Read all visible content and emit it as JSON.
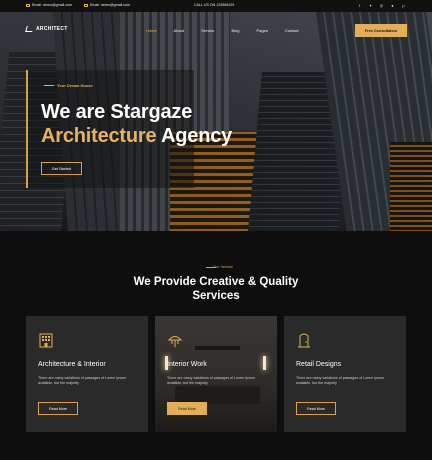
{
  "topbar": {
    "email1": "Email: demo@gmail.com",
    "email2": "Email: demo@gmail.com",
    "call": "CALL US ON 125566429",
    "socials": [
      "facebook-icon",
      "twitter-icon",
      "instagram-icon",
      "skype-icon",
      "pinterest-icon"
    ]
  },
  "nav": {
    "logo": "ARCHITECT",
    "items": [
      "Home",
      "About",
      "Service",
      "Blog",
      "Pages",
      "Contact"
    ],
    "active": "Home",
    "cta": "Free Consultation"
  },
  "hero": {
    "tagline": "Your Dream House",
    "heading_line1": "We are Stargaze",
    "heading_gold": "Architecture",
    "heading_rest": " Agency",
    "button": "Get Started"
  },
  "services": {
    "subtitle": "Our Service",
    "title_line1": "We Provide Creative & Quality",
    "title_line2": "Services",
    "cards": [
      {
        "icon": "building-icon",
        "title": "Architecture & Interior",
        "text": "There are many variations of passages of Lorem Ipsum available, but the majority",
        "button": "Read More"
      },
      {
        "icon": "lamp-icon",
        "title": "Interior Work",
        "text": "There are many variations of passages of Lorem Ipsum available, but the majority",
        "button": "Read More"
      },
      {
        "icon": "door-icon",
        "title": "Retail Designs",
        "text": "There are many variations of passages of Lorem Ipsum available, but the majority",
        "button": "Read More"
      }
    ]
  },
  "colors": {
    "accent": "#e3ad59",
    "background": "#0e0e0e",
    "card": "#2a2a2a"
  }
}
